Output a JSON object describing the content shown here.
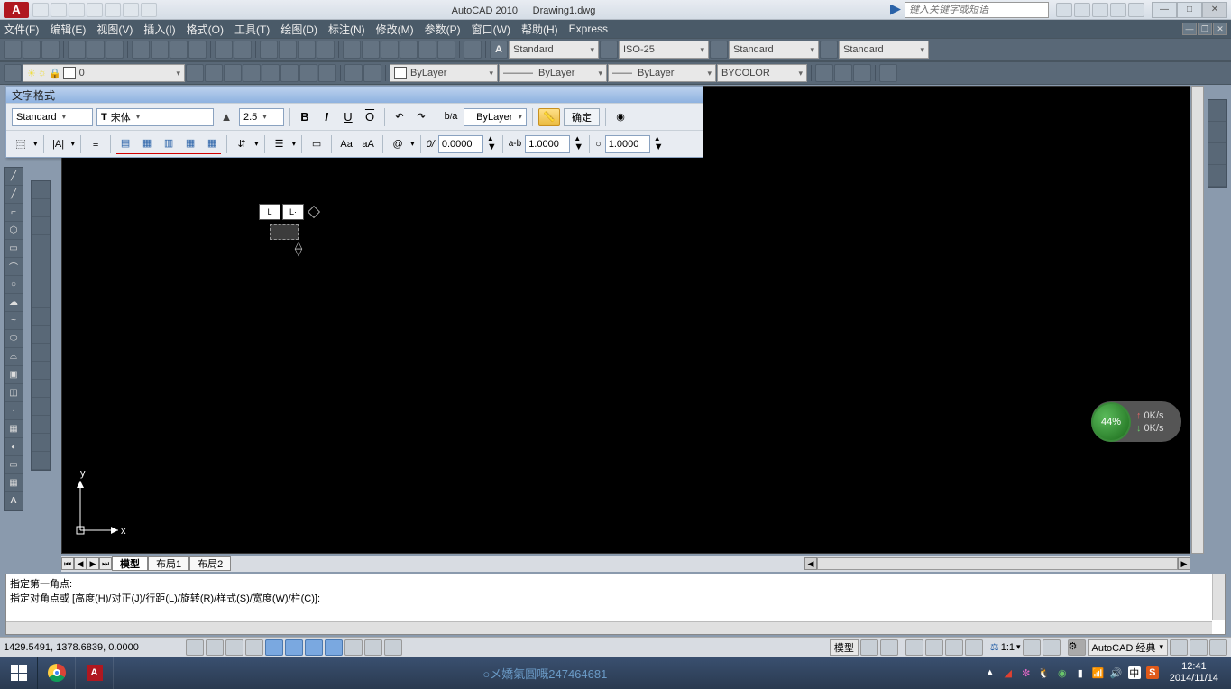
{
  "titlebar": {
    "logo": "A",
    "app_name": "AutoCAD 2010",
    "doc_name": "Drawing1.dwg",
    "search_placeholder": "键入关键字或短语",
    "min": "—",
    "max": "□",
    "close": "✕"
  },
  "menu": {
    "items": [
      "文件(F)",
      "编辑(E)",
      "视图(V)",
      "插入(I)",
      "格式(O)",
      "工具(T)",
      "绘图(D)",
      "标注(N)",
      "修改(M)",
      "参数(P)",
      "窗口(W)",
      "帮助(H)",
      "Express"
    ]
  },
  "styles": {
    "text": "Standard",
    "dim": "ISO-25",
    "table": "Standard",
    "mleader": "Standard"
  },
  "layer": {
    "name": "0",
    "color_linetype": "ByLayer",
    "lineweight": "ByLayer",
    "plotstyle": "BYCOLOR"
  },
  "text_format": {
    "title": "文字格式",
    "style": "Standard",
    "font": "宋体",
    "font_prefix": "T",
    "height": "2.5",
    "color": "ByLayer",
    "ok": "确定",
    "bold": "B",
    "italic": "I",
    "underline": "U",
    "overline": "O",
    "at": "@",
    "oblique": "0/",
    "oblique_val": "0.0000",
    "tracking_label": "a-b",
    "tracking": "1.0000",
    "widthfactor": "1.0000",
    "caseAa": "Aa",
    "caseaA": "aA"
  },
  "model_tabs": {
    "model": "模型",
    "layout1": "布局1",
    "layout2": "布局2"
  },
  "ucs": {
    "x": "x",
    "y": "y"
  },
  "cmd": {
    "line1": "指定第一角点:",
    "line2": "指定对角点或 [高度(H)/对正(J)/行距(L)/旋转(R)/样式(S)/宽度(W)/栏(C)]:"
  },
  "status": {
    "coords": "1429.5491, 1378.6839, 0.0000",
    "model": "模型",
    "scale": "1:1",
    "ws": "AutoCAD 经典"
  },
  "netspeed": {
    "pct": "44%",
    "up": "0K/s",
    "down": "0K/s"
  },
  "taskbar": {
    "watermark": "○メ嬌氣圓嘅247464681",
    "time": "12:41",
    "date": "2014/11/14",
    "ime": "中",
    "sogou": "S"
  }
}
